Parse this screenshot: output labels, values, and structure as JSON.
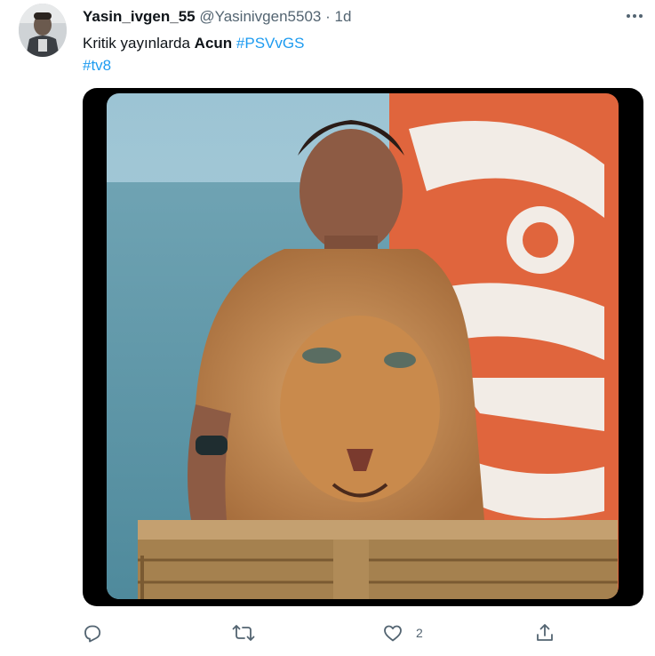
{
  "tweet": {
    "display_name": "Yasin_ivgen_55",
    "handle": "@Yasinivgen5503",
    "separator": "·",
    "time": "1d",
    "text_plain": "Kritik yayınlarda ",
    "text_bold": "Acun",
    "hashtag_1": "#PSVvGS",
    "hashtag_2": "#tv8"
  },
  "actions": {
    "reply_icon": "reply-icon",
    "retweet_icon": "retweet-icon",
    "like_icon": "like-icon",
    "like_count": "2",
    "share_icon": "share-icon"
  },
  "colors": {
    "text": "#0f1419",
    "secondary": "#536471",
    "link": "#1d9bf0",
    "media_frame": "#000000"
  }
}
